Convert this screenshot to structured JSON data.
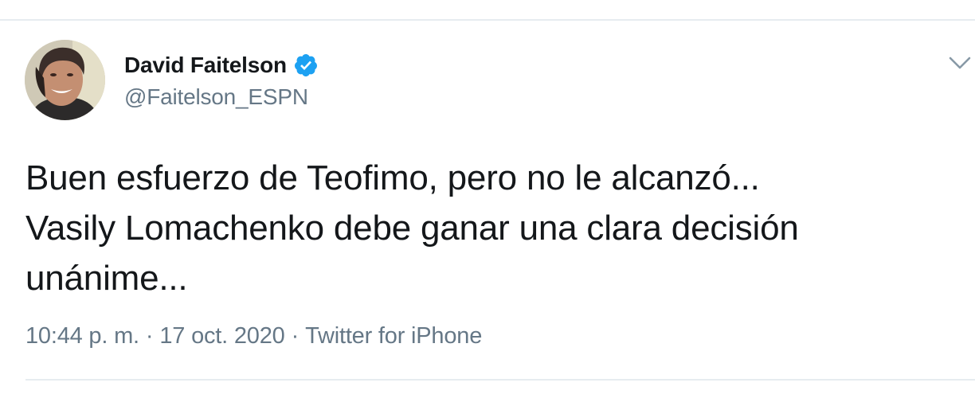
{
  "author": {
    "display_name": "David Faitelson",
    "handle": "@Faitelson_ESPN",
    "verified": true
  },
  "tweet": {
    "text_lines": [
      "Buen esfuerzo de Teofimo, pero no le alcanzó...",
      "Vasily Lomachenko debe ganar una clara decisión",
      "unánime..."
    ],
    "time": "10:44 p. m.",
    "date": "17 oct. 2020",
    "separator": "·",
    "source": "Twitter for iPhone"
  },
  "icons": {
    "verified": "verified-badge-icon",
    "menu": "chevron-down-icon"
  },
  "colors": {
    "text_primary": "#14171a",
    "text_secondary": "#657786",
    "verified_blue": "#1da1f2",
    "divider": "#e6ecf0"
  }
}
